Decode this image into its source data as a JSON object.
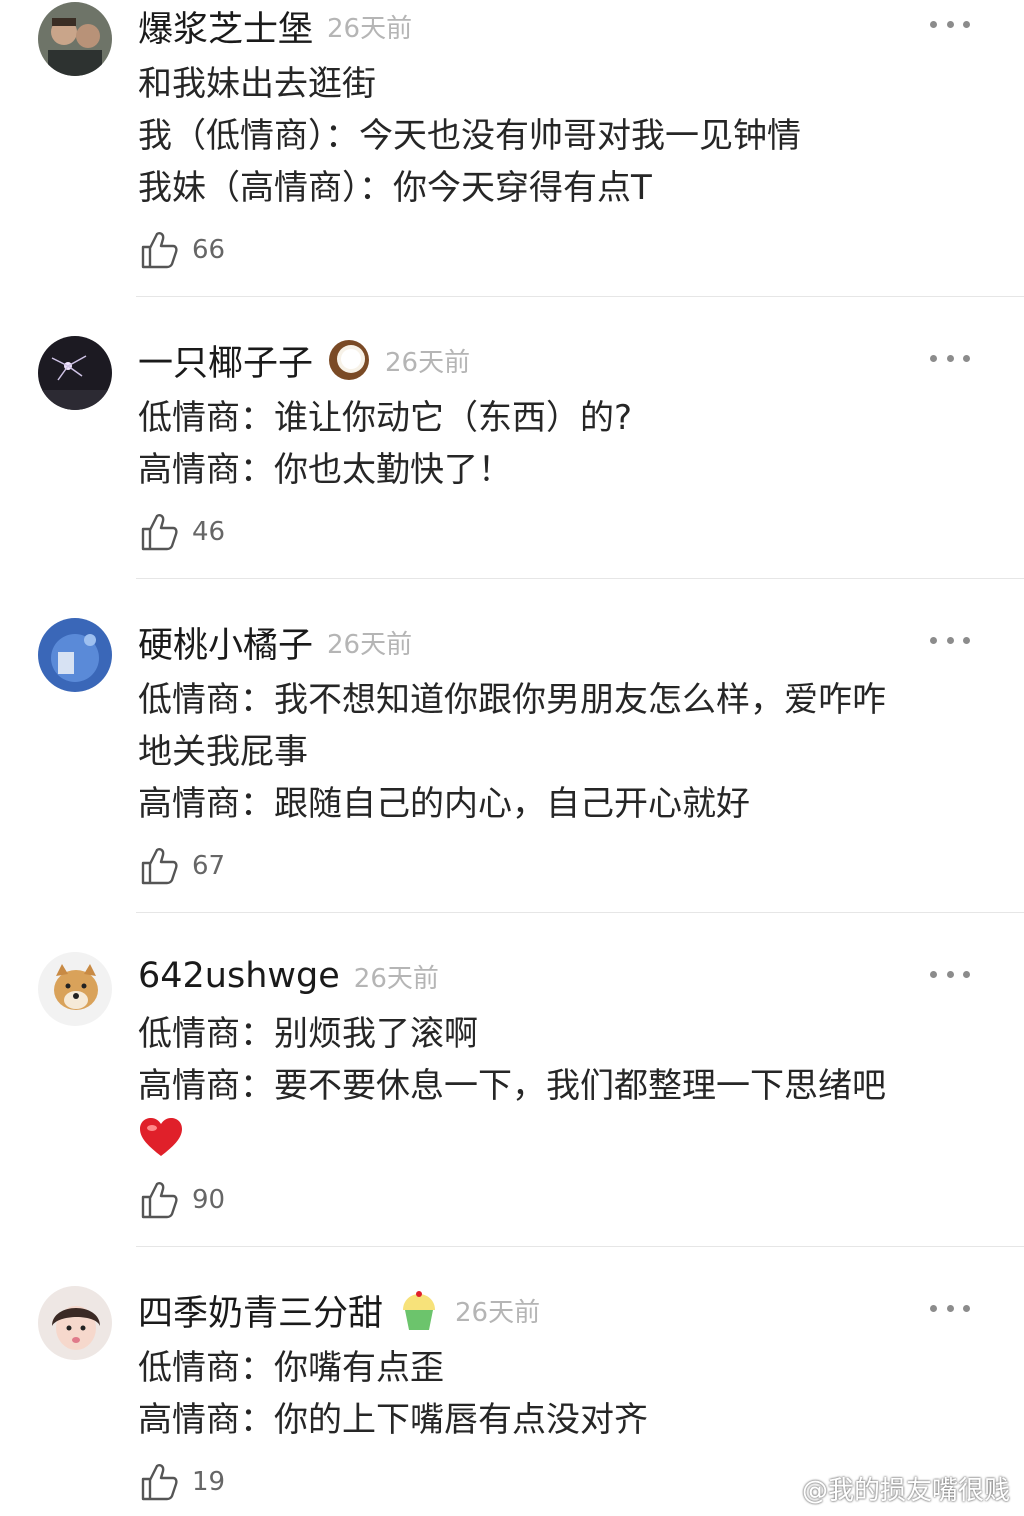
{
  "comments": [
    {
      "username": "爆浆芝士堡",
      "time": "26天前",
      "lines": [
        "和我妹出去逛街",
        "我（低情商）：今天也没有帅哥对我一见钟情",
        "我妹（高情商）：你今天穿得有点T"
      ],
      "likes": "66"
    },
    {
      "username": "一只椰子子",
      "time": "26天前",
      "badge_emoji": "coconut-emoji",
      "lines": [
        "低情商：谁让你动它（东西）的?",
        "高情商：你也太勤快了！"
      ],
      "likes": "46"
    },
    {
      "username": "硬桃小橘子",
      "time": "26天前",
      "lines": [
        "低情商：我不想知道你跟你男朋友怎么样，爱咋咋",
        "地关我屁事",
        "高情商：跟随自己的内心，自己开心就好"
      ],
      "likes": "67"
    },
    {
      "username": "642ushwge",
      "time": "26天前",
      "lines": [
        "低情商：别烦我了滚啊",
        "高情商：要不要休息一下，我们都整理一下思绪吧"
      ],
      "trailing_emoji": "red-heart-emoji",
      "likes": "90"
    },
    {
      "username": "四季奶青三分甜",
      "time": "26天前",
      "badge_emoji": "cupcake-emoji",
      "lines": [
        "低情商：你嘴有点歪",
        "高情商：你的上下嘴唇有点没对齐"
      ],
      "likes": "19"
    }
  ],
  "watermark": "@我的损友嘴很贱",
  "colors": {
    "time": "#b5b5b5",
    "text": "#262626",
    "divider": "#e6e6e6",
    "heart": "#e0202a"
  }
}
